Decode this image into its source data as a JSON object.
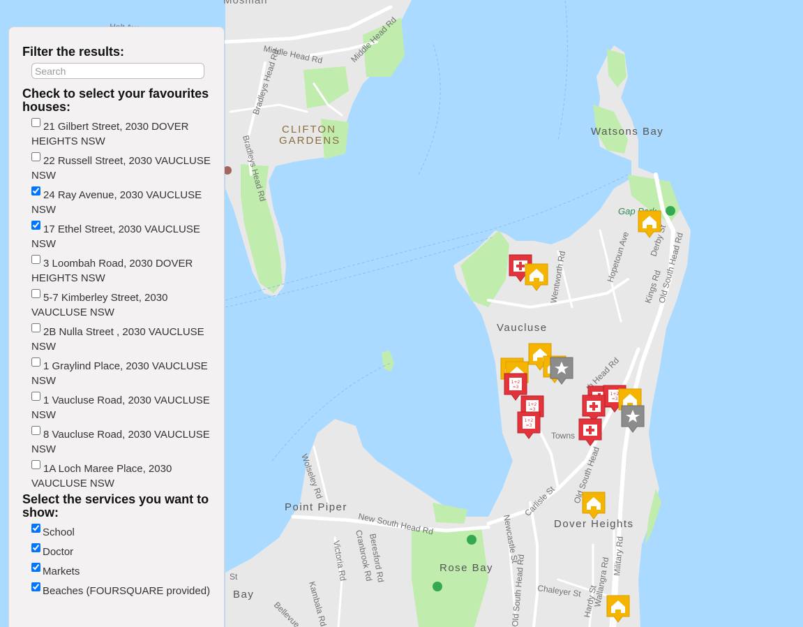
{
  "filter": {
    "heading": "Filter the results:",
    "search_placeholder": "Search",
    "search_value": ""
  },
  "favourites": {
    "heading": "Check to select your favourites houses:",
    "houses": [
      {
        "address": "21 Gilbert Street, 2030 DOVER HEIGHTS NSW",
        "checked": false
      },
      {
        "address": "22 Russell Street, 2030 VAUCLUSE NSW",
        "checked": false
      },
      {
        "address": "24 Ray Avenue, 2030 VAUCLUSE NSW",
        "checked": true
      },
      {
        "address": "17 Ethel Street, 2030 VAUCLUSE NSW",
        "checked": true
      },
      {
        "address": "3 Loombah Road, 2030 DOVER HEIGHTS NSW",
        "checked": false
      },
      {
        "address": "5-7 Kimberley Street, 2030 VAUCLUSE NSW",
        "checked": false
      },
      {
        "address": "2B Nulla Street , 2030 VAUCLUSE NSW",
        "checked": false
      },
      {
        "address": "1 Graylind Place, 2030 VAUCLUSE NSW",
        "checked": false
      },
      {
        "address": "1 Vaucluse Road, 2030 VAUCLUSE NSW",
        "checked": false
      },
      {
        "address": "8 Vaucluse Road, 2030 VAUCLUSE NSW",
        "checked": false
      },
      {
        "address": "1A Loch Maree Place, 2030 VAUCLUSE NSW",
        "checked": false
      }
    ]
  },
  "services": {
    "heading": "Select the services you want to show:",
    "items": [
      {
        "label": "School",
        "checked": true
      },
      {
        "label": "Doctor",
        "checked": true
      },
      {
        "label": "Markets",
        "checked": true
      },
      {
        "label": "Beaches (FOURSQUARE provided)",
        "checked": true
      }
    ]
  },
  "map": {
    "water_color": "#aadaff",
    "land_color": "#e8e8e8",
    "park_color": "#c0ecae",
    "road_color": "#ffffff",
    "marker_colors": {
      "house": "#f5b400",
      "doctor": "#e3343c",
      "school": "#e3343c",
      "beach": "#8c8c8c"
    },
    "labels": {
      "mosman": "Mosman",
      "holt_ave": "Holt Ave",
      "middle_head_rd": "Middle Head Rd",
      "middle_head_rd_2": "Middle Head Rd",
      "bradleys_head_rd": "Bradleys Head Rd",
      "bradleys_head_rd_2": "Bradleys Head Rd",
      "clifton": "CLIFTON",
      "gardens": "GARDENS",
      "watsons_bay": "Watsons Bay",
      "gap_park": "Gap Park",
      "hopetoun_ave": "Hopetoun Ave",
      "derby_st": "Derby St",
      "kings_rd": "Kings Rd",
      "old_south_head_rd": "Old South Head Rd",
      "wentworth_rd": "Wentworth Rd",
      "vaucluse": "Vaucluse",
      "th_head_rd": "th Head Rd",
      "towns": "Towns",
      "old_south_head": "Old South Head",
      "carlisle_st": "Carlisle St",
      "dover_heights": "Dover Heights",
      "point_piper": "Point Piper",
      "wolseley_rd": "Wolseley Rd",
      "new_south_head_rd": "New South Head Rd",
      "victoria_rd": "Victoria Rd",
      "cranbrook_rd": "Cranbrook Rd",
      "beresford_rd": "Beresford Rd",
      "newcastle_st": "Newcastle St",
      "old_south_head_rd_2": "Old South Head Rd",
      "rose_bay": "Rose Bay",
      "chaleyer_st": "Chaleyer St",
      "hardy_st": "Hardy St",
      "wallangra_rd": "Wallangra Rd",
      "military_rd": "Military Rd",
      "kambala_rd": "Kambala Rd",
      "bellevue": "Bellevue",
      "bay": "Bay",
      "st": "St"
    }
  }
}
